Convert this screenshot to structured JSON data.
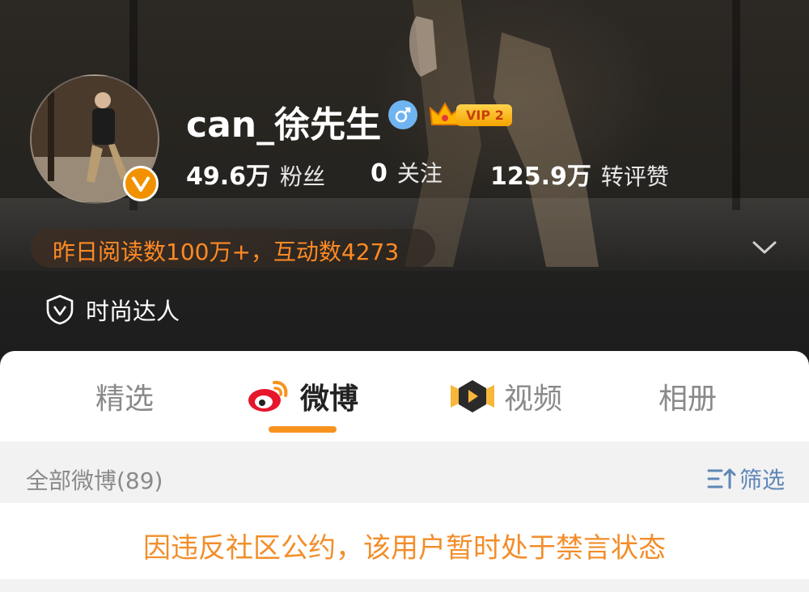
{
  "profile": {
    "username": "can_徐先生",
    "vip_label": "VIP 2",
    "gender_icon": "male-icon",
    "verified_icon": "verified-v-icon"
  },
  "stats": [
    {
      "value": "49.6万",
      "label": "粉丝"
    },
    {
      "value": "0",
      "label": "关注"
    },
    {
      "value": "125.9万",
      "label": "转评赞"
    }
  ],
  "reading_summary": "昨日阅读数100万+，互动数4273",
  "tag": {
    "icon": "shield-v-icon",
    "label": "时尚达人"
  },
  "tabs": [
    {
      "label": "精选",
      "icon": null
    },
    {
      "label": "微博",
      "icon": "weibo-icon",
      "active": true
    },
    {
      "label": "视频",
      "icon": "video-play-icon"
    },
    {
      "label": "相册",
      "icon": null
    }
  ],
  "feed": {
    "title": "全部微博(89)",
    "filter_label": "筛选",
    "filter_icon": "filter-sort-icon"
  },
  "notice": "因违反社区公约，该用户暂时处于禁言状态",
  "colors": {
    "accent_orange": "#f7931e",
    "notice_orange": "#f28e2b",
    "link_blue": "#5f87b8",
    "gender_blue": "#6fb4f0"
  }
}
